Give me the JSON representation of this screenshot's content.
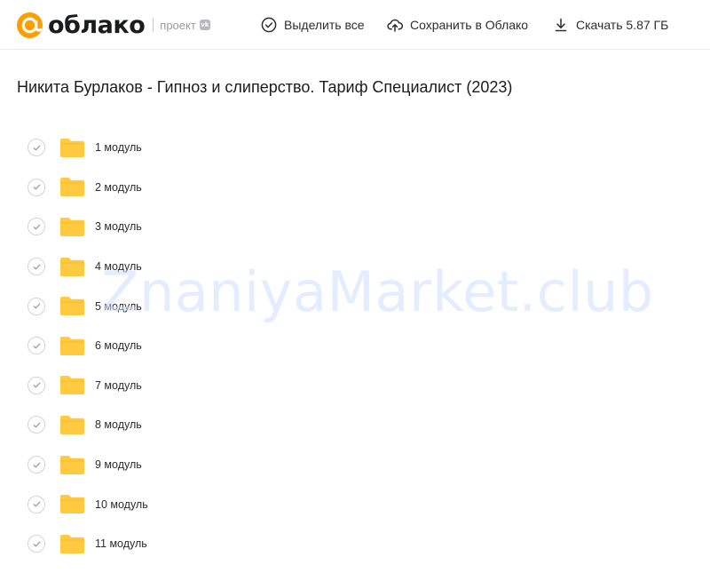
{
  "header": {
    "logo_text": "облако",
    "project_label": "проект",
    "vk_badge": "vk",
    "actions": {
      "select_all": "Выделить все",
      "save_to_cloud": "Сохранить в Облако",
      "download": "Скачать 5.87 ГБ"
    }
  },
  "folder": {
    "title": "Никита Бурлаков - Гипноз и слиперство. Тариф Специалист (2023)",
    "items": [
      {
        "label": "1 модуль"
      },
      {
        "label": "2 модуль"
      },
      {
        "label": "3 модуль"
      },
      {
        "label": "4 модуль"
      },
      {
        "label": "5 модуль"
      },
      {
        "label": "6 модуль"
      },
      {
        "label": "7 модуль"
      },
      {
        "label": "8 модуль"
      },
      {
        "label": "9 модуль"
      },
      {
        "label": "10 модуль"
      },
      {
        "label": "11 модуль"
      }
    ]
  },
  "watermark": "ZnaniyaMarket.club",
  "colors": {
    "brand_orange": "#ff9e00",
    "folder_yellow": "#ffc940",
    "text": "#2c2d2e",
    "watermark": "#cfe0ff"
  },
  "icons": [
    "cloud-logo-icon",
    "check-circle-icon",
    "cloud-upload-icon",
    "download-icon",
    "folder-icon"
  ]
}
